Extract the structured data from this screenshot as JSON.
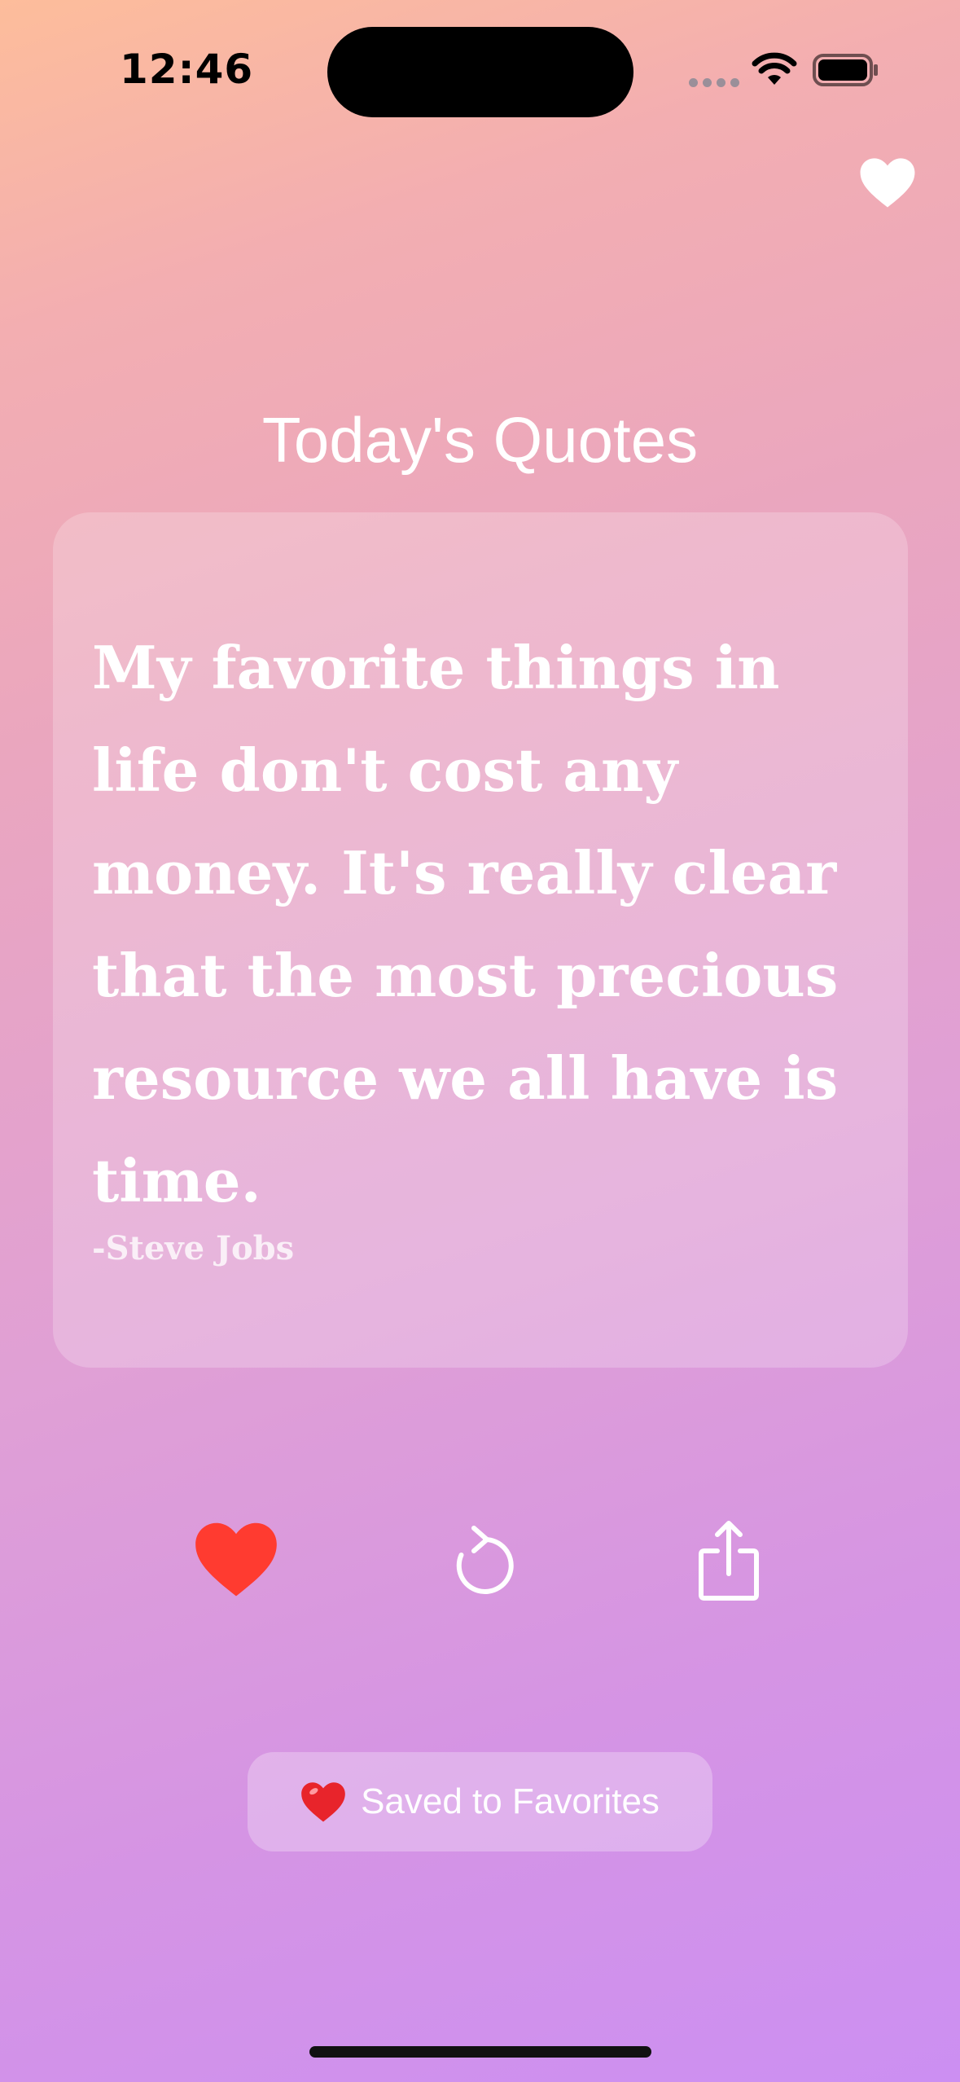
{
  "status_bar": {
    "time": "12:46"
  },
  "header": {
    "favorites_icon": "heart-icon"
  },
  "main": {
    "title": "Today's Quotes",
    "quote": {
      "text": "My favorite things in life don't cost any money. It's really clear that the most precious resource we all have is time.",
      "author": "-Steve Jobs"
    }
  },
  "actions": [
    {
      "icon": "heart-filled-icon",
      "color": "#ff3b30"
    },
    {
      "icon": "refresh-icon",
      "color": "#ffffff"
    },
    {
      "icon": "share-icon",
      "color": "#ffffff"
    }
  ],
  "toast": {
    "emoji": "heart-emoji",
    "label": "Saved to Favorites"
  }
}
